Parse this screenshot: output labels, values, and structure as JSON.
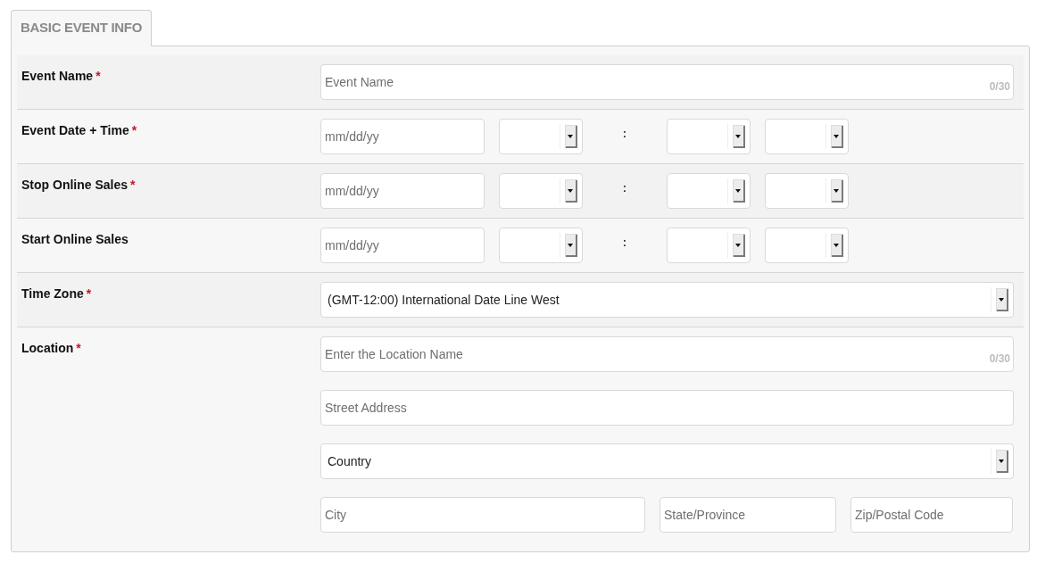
{
  "tabs": [
    {
      "label": "BASIC EVENT INFO",
      "selected": true
    }
  ],
  "rows": [
    {
      "label": "Event Name",
      "required_mark": "*",
      "lines": [
        {
          "kind": "single",
          "controls": [
            {
              "kind": "text",
              "placeholder": "Event Name",
              "counter": "0/30"
            }
          ]
        }
      ]
    },
    {
      "label": "Event Date + Time",
      "required_mark": "*",
      "lines": [
        {
          "kind": "datetime",
          "controls": [
            {
              "kind": "text",
              "placeholder": "mm/dd/yy"
            },
            {
              "kind": "select"
            },
            {
              "kind": "separator",
              "text": ":"
            },
            {
              "kind": "select"
            },
            {
              "kind": "select"
            }
          ]
        }
      ]
    },
    {
      "label": "Stop Online Sales",
      "required_mark": "*",
      "lines": [
        {
          "kind": "datetime",
          "controls": [
            {
              "kind": "text",
              "placeholder": "mm/dd/yy"
            },
            {
              "kind": "select"
            },
            {
              "kind": "separator",
              "text": ":"
            },
            {
              "kind": "select"
            },
            {
              "kind": "select"
            }
          ]
        }
      ]
    },
    {
      "label": "Start Online Sales",
      "lines": [
        {
          "kind": "datetime",
          "controls": [
            {
              "kind": "text",
              "placeholder": "mm/dd/yy"
            },
            {
              "kind": "select"
            },
            {
              "kind": "separator",
              "text": ":"
            },
            {
              "kind": "select"
            },
            {
              "kind": "select"
            }
          ]
        }
      ]
    },
    {
      "label": "Time Zone",
      "required_mark": "*",
      "lines": [
        {
          "kind": "single",
          "controls": [
            {
              "kind": "select",
              "value": "(GMT-12:00) International Date Line West"
            }
          ]
        }
      ]
    },
    {
      "label": "Location",
      "required_mark": "*",
      "lines": [
        {
          "kind": "single",
          "controls": [
            {
              "kind": "text",
              "placeholder": "Enter the Location Name",
              "counter": "0/30"
            }
          ]
        },
        {
          "kind": "single",
          "controls": [
            {
              "kind": "text",
              "placeholder": "Street Address"
            }
          ]
        },
        {
          "kind": "single",
          "controls": [
            {
              "kind": "select",
              "value": "Country"
            }
          ]
        },
        {
          "kind": "address",
          "controls": [
            {
              "kind": "text",
              "placeholder": "City"
            },
            {
              "kind": "text",
              "placeholder": "State/Province"
            },
            {
              "kind": "text",
              "placeholder": "Zip/Postal Code"
            }
          ]
        }
      ]
    }
  ]
}
